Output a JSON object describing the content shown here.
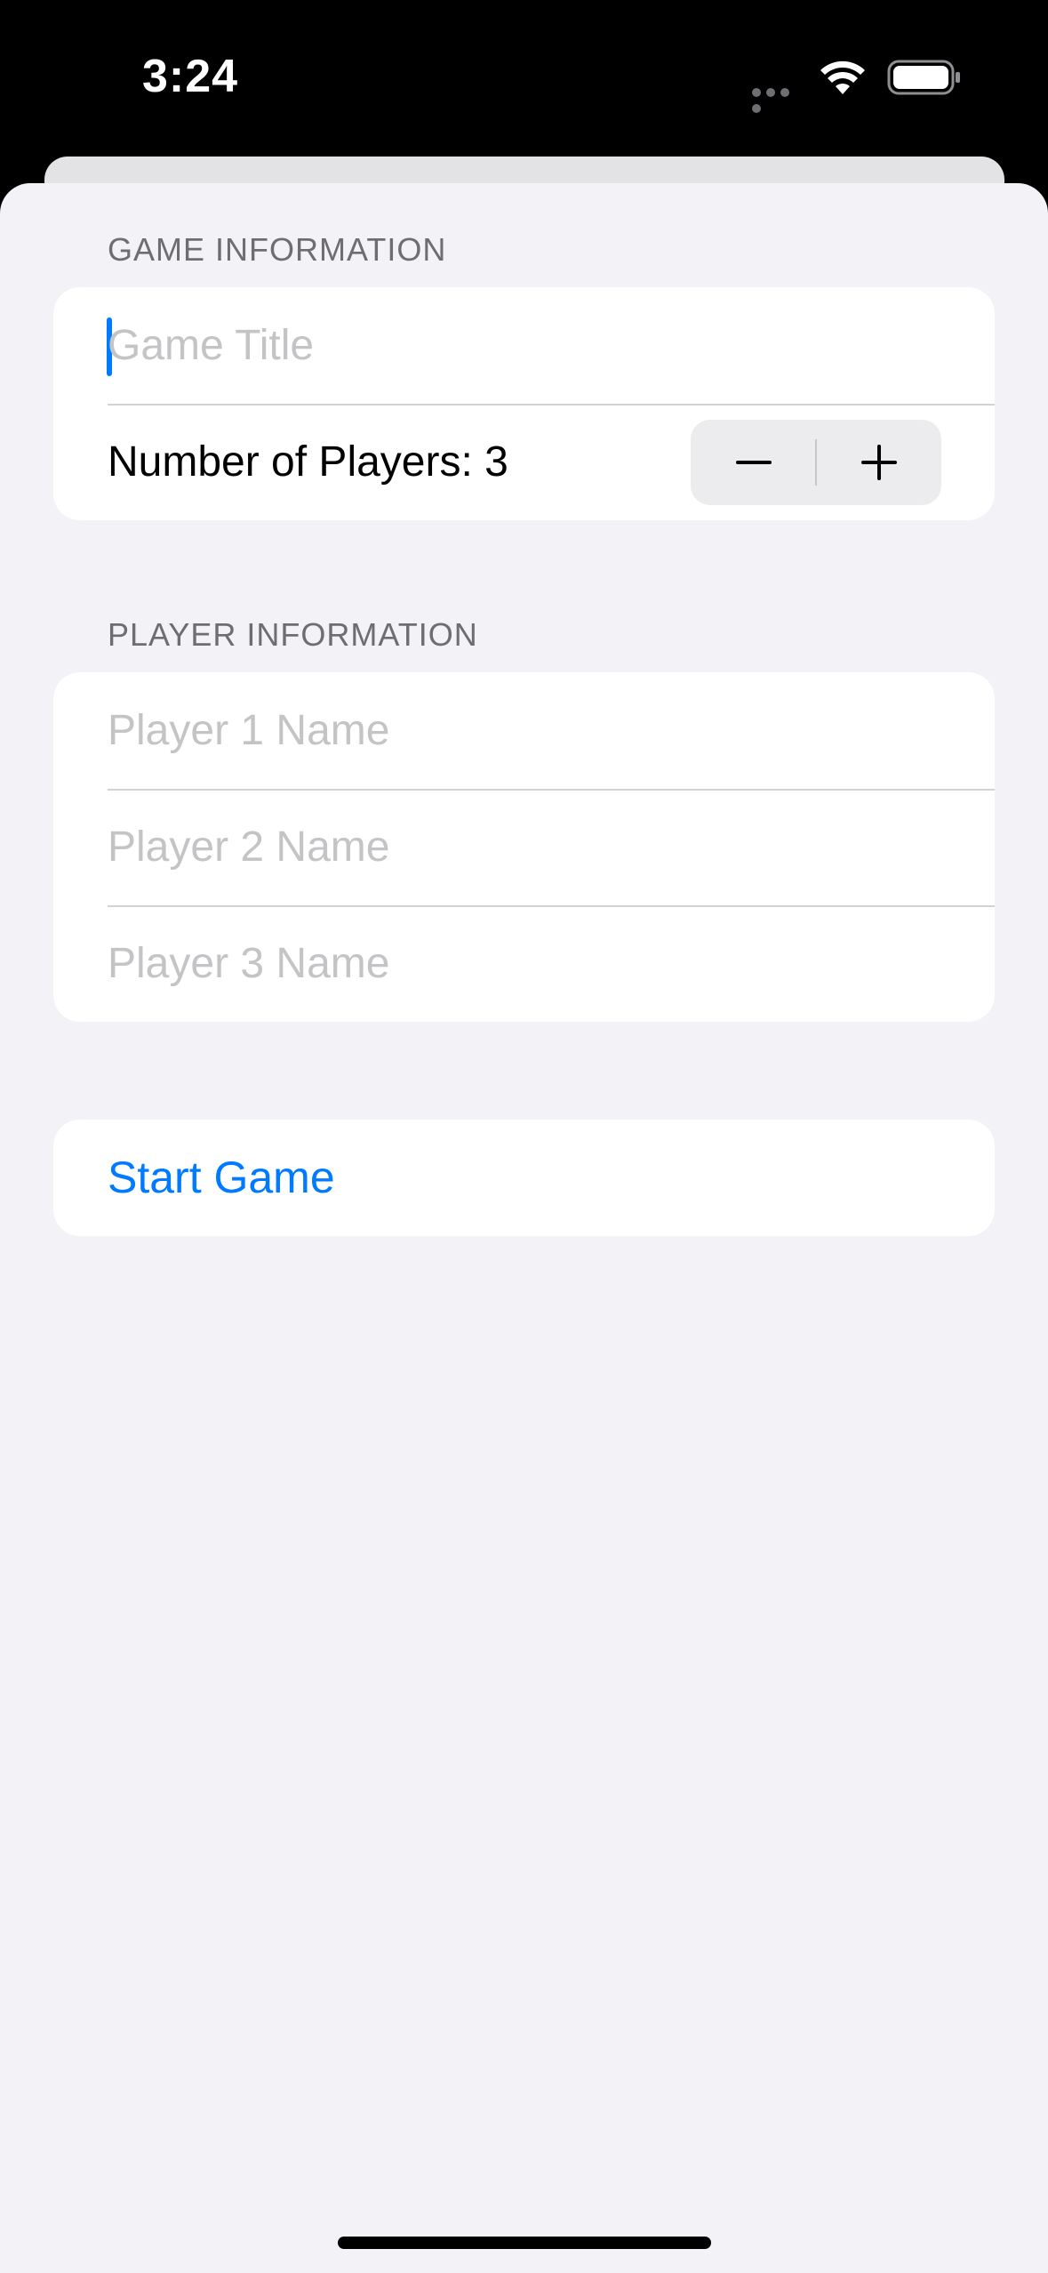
{
  "status_bar": {
    "time": "3:24",
    "icons": [
      "signal-dots-icon",
      "wifi-icon",
      "battery-icon"
    ]
  },
  "game_section": {
    "header": "GAME INFORMATION",
    "title_field": {
      "value": "",
      "placeholder": "Game Title"
    },
    "players_label": "Number of Players: 3",
    "stepper": {
      "decrement_icon": "minus-icon",
      "increment_icon": "plus-icon"
    }
  },
  "player_section": {
    "header": "PLAYER INFORMATION",
    "fields": [
      {
        "value": "",
        "placeholder": "Player 1 Name"
      },
      {
        "value": "",
        "placeholder": "Player 2 Name"
      },
      {
        "value": "",
        "placeholder": "Player 3 Name"
      }
    ]
  },
  "start_button": {
    "label": "Start Game"
  },
  "colors": {
    "accent": "#007aff",
    "background": "#f2f2f7",
    "card": "#ffffff",
    "placeholder": "#c4c4c7",
    "section_header": "#6d6d72"
  }
}
